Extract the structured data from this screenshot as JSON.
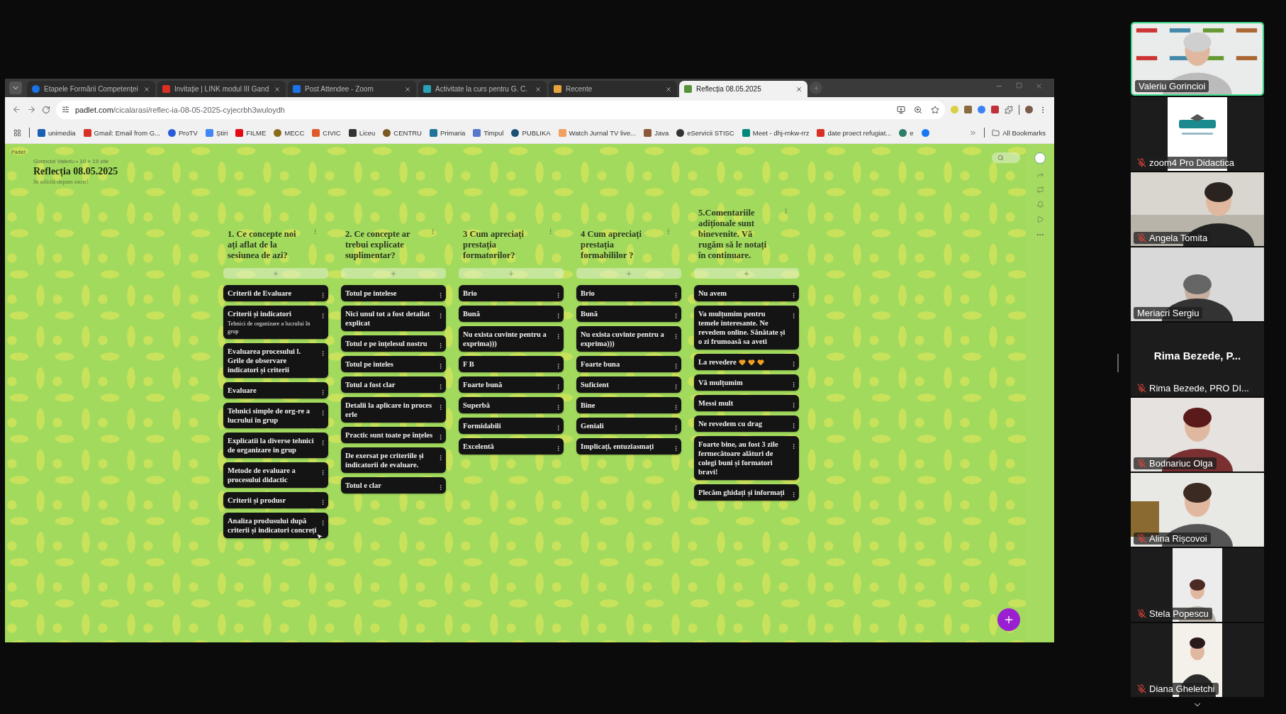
{
  "browser": {
    "tabs": [
      {
        "title": "Etapele Formării Competenței",
        "selected": false
      },
      {
        "title": "Invitație | LINK modul III Gand",
        "selected": false
      },
      {
        "title": "Post Attendee - Zoom",
        "selected": false
      },
      {
        "title": "Activitate la curs pentru G. C.",
        "selected": false
      },
      {
        "title": "Recente",
        "selected": false
      },
      {
        "title": "Reflecția 08.05.2025",
        "selected": true
      }
    ],
    "address": {
      "host": "padlet.com",
      "path": "/cicalarasi/reflec-ia-08-05-2025-cyjecrbh3wuloydh"
    },
    "bookmarks": [
      "unimedia",
      "Gmail: Email from G...",
      "ProTV",
      "Știri",
      "FILME",
      "MECC",
      "CIVIC",
      "Liceu",
      "CENTRU",
      "Primaria",
      "Timpul",
      "PUBLIKA",
      "Watch Jurnal TV live...",
      "Java",
      "eServicii STISC",
      "Meet - dhj-rnkw-rrz",
      "date proect refugiat...",
      "e"
    ],
    "all_bookmarks": "All Bookmarks"
  },
  "padlet": {
    "brand": "Padlet",
    "author": "Gorincioi Valeriu • 10 × 19 zile",
    "title": "Reflecția  08.05.2025",
    "subtitle": "Se solicită răspuns sincer!",
    "columns": [
      {
        "heading": "1. Ce concepte noi ați aflat de la sesiunea de azi?",
        "posts": [
          {
            "kind": "text",
            "title": "Criterii de Evaluare"
          },
          {
            "kind": "text",
            "title": "Criterii și indicatori",
            "body": "Tehnici de organizare a lucrului în grup"
          },
          {
            "kind": "text",
            "title": "Evaluarea procesului l. Grile de observare indicatori și criterii"
          },
          {
            "kind": "text",
            "title": "Evaluare"
          },
          {
            "kind": "text",
            "title": "Tehnici simple de org-re a lucrului în grup"
          },
          {
            "kind": "text",
            "title": "Explicatii la diverse tehnici de organizare in grup"
          },
          {
            "kind": "text",
            "title": "Metode de evaluare a procesului didactic"
          },
          {
            "kind": "text",
            "title": "Criterii și produsr"
          },
          {
            "kind": "text",
            "title": "Analiza produsului după criterii și indicatori concreți"
          }
        ]
      },
      {
        "heading": "2. Ce  concepte ar trebui explicate suplimentar?",
        "posts": [
          {
            "kind": "text",
            "title": "Totul pe intelese"
          },
          {
            "kind": "text",
            "title": "Nici unul tot a fost detailat explicat"
          },
          {
            "kind": "text",
            "title": "Totul e pe înțelesul nostru"
          },
          {
            "kind": "text",
            "title": "Totul pe inteles"
          },
          {
            "kind": "text",
            "title": "Totul a fost clar"
          },
          {
            "kind": "text",
            "title": "Detalii la aplicare in proces erle"
          },
          {
            "kind": "text",
            "title": "Practic sunt toate pe înțeles"
          },
          {
            "kind": "text",
            "title": "De exersat pe criteriile și indicatorii de evaluare."
          },
          {
            "kind": "text",
            "title": "Totul e clar"
          }
        ]
      },
      {
        "heading": "3 Cum apreciați prestația formatorilor?",
        "posts": [
          {
            "kind": "text",
            "title": "Brio"
          },
          {
            "kind": "text",
            "title": "Bună"
          },
          {
            "kind": "text",
            "title": "Nu exista cuvinte pentru a exprima)))"
          },
          {
            "kind": "text",
            "title": "F B"
          },
          {
            "kind": "text",
            "title": "Foarte bună"
          },
          {
            "kind": "text",
            "title": "Superbă"
          },
          {
            "kind": "text",
            "title": "Formidabili"
          },
          {
            "kind": "text",
            "title": "Excelentă"
          }
        ]
      },
      {
        "heading": "4  Cum apreciați prestația formabililor ?",
        "posts": [
          {
            "kind": "text",
            "title": "Brio"
          },
          {
            "kind": "text",
            "title": "Bună"
          },
          {
            "kind": "text",
            "title": "Nu exista cuvinte pentru a exprima)))"
          },
          {
            "kind": "text",
            "title": "Foarte buna"
          },
          {
            "kind": "text",
            "title": "Suficient"
          },
          {
            "kind": "text",
            "title": "Bine"
          },
          {
            "kind": "text",
            "title": "Geniali"
          },
          {
            "kind": "text",
            "title": "Implicați, entuziasmați"
          }
        ]
      },
      {
        "heading": "5.Comentariile adiționale sunt binevenite. Vă rugăm să le notați în continuare.",
        "posts": [
          {
            "kind": "text",
            "title": "Nu avem"
          },
          {
            "kind": "text",
            "title": "Va mulțumim pentru temele interesante. Ne revedem online. Sănătate și o zi frumoasă sa aveti"
          },
          {
            "kind": "hearts",
            "title": "La revedere"
          },
          {
            "kind": "text",
            "title": "Vă mulțumim"
          },
          {
            "kind": "text",
            "title": "Messi mult"
          },
          {
            "kind": "text",
            "title": "Ne revedem cu drag"
          },
          {
            "kind": "text",
            "title": "Foarte bine, au fost 3 zile fermecătoare alături de colegi buni și formatori bravi!"
          },
          {
            "kind": "text",
            "title": "Plecăm ghidați și informați"
          }
        ]
      }
    ]
  },
  "participants": [
    {
      "name": "Valeriu Gorincioi",
      "kind": "video",
      "muted": false,
      "speaking": true
    },
    {
      "name": "zoom4 Pro Didactica",
      "kind": "avatar",
      "muted": true,
      "speaking": false
    },
    {
      "name": "Angela Tomita",
      "kind": "video",
      "muted": true,
      "speaking": false
    },
    {
      "name": "Meriacri Sergiu",
      "kind": "video",
      "muted": false,
      "speaking": false
    },
    {
      "name": "Rima Bezede, PRO DI...",
      "kind": "name",
      "title": "Rima Bezede, P...",
      "muted": true,
      "speaking": false
    },
    {
      "name": "Bodnariuc Olga",
      "kind": "video",
      "muted": true,
      "speaking": false
    },
    {
      "name": "Alina Rișcovoi",
      "kind": "video",
      "muted": true,
      "speaking": false
    },
    {
      "name": "Stela Popescu",
      "kind": "narrow",
      "muted": true,
      "speaking": false
    },
    {
      "name": "Diana Gheletchi",
      "kind": "narrow",
      "muted": true,
      "speaking": false
    }
  ]
}
